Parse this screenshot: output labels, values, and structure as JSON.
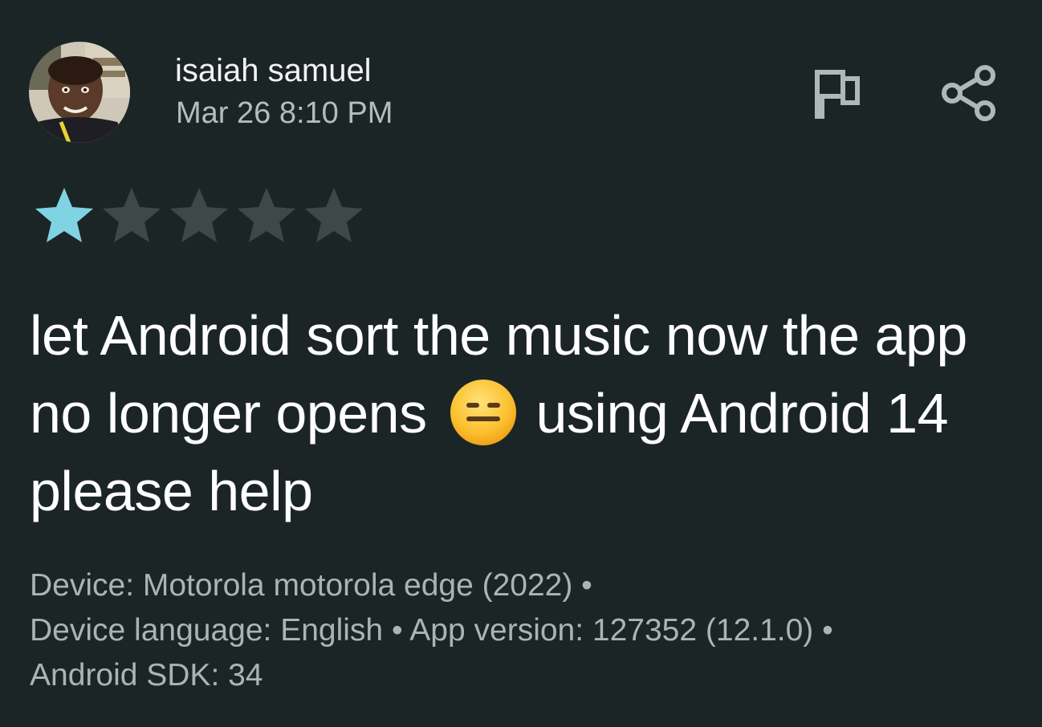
{
  "review": {
    "author": "isaiah samuel",
    "date": "Mar 26 8:10 PM",
    "rating": {
      "value": 1,
      "max": 5
    },
    "text_before_emoji": "let Android sort the music now the app no longer opens",
    "emoji": "neutral-face-emoji",
    "text_after_emoji": "using Android 14 please help",
    "meta": {
      "line1": "Device: Motorola motorola edge (2022) •",
      "line2": "Device language: English • App version: 127352 (12.1.0) •",
      "line3": "Android SDK: 34"
    }
  },
  "actions": {
    "flag_icon": "flag-icon",
    "share_icon": "share-icon"
  },
  "colors": {
    "background": "#1c2526",
    "star_filled": "#7fd3e3",
    "star_empty": "#3e4849",
    "meta_text": "#aab4b5",
    "date_text": "#b3bdbd"
  }
}
